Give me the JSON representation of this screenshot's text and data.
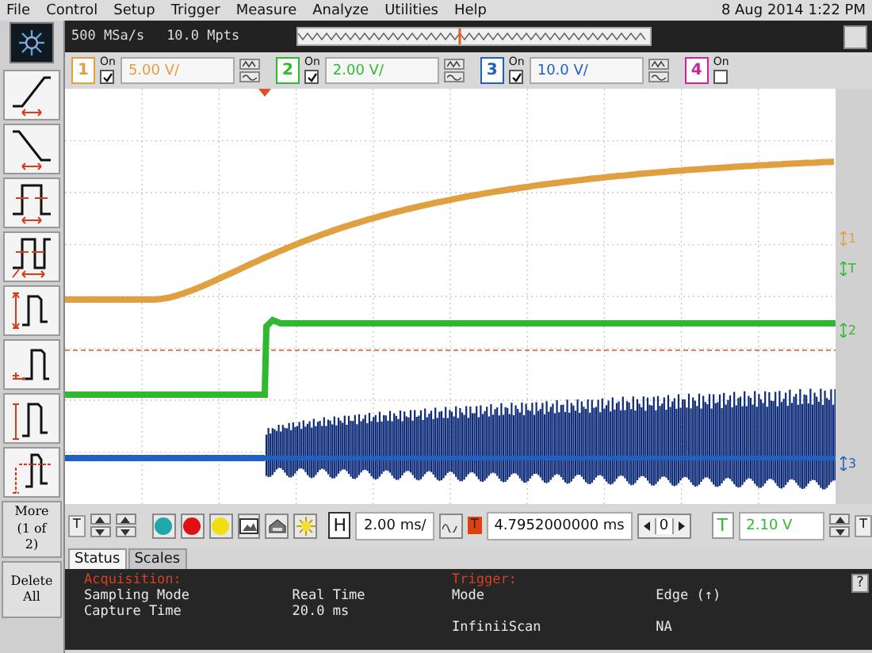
{
  "menu": [
    "File",
    "Control",
    "Setup",
    "Trigger",
    "Measure",
    "Analyze",
    "Utilities",
    "Help"
  ],
  "datetime": "8 Aug 2014  1:22 PM",
  "acquisition_bar": {
    "sample_rate": "500 MSa/s",
    "memory_depth": "10.0 Mpts"
  },
  "channels": [
    {
      "number": "1",
      "on_label": "On",
      "on": true,
      "scale": "5.00 V/",
      "color": "#e0a040"
    },
    {
      "number": "2",
      "on_label": "On",
      "on": true,
      "scale": "2.00 V/",
      "color": "#30b830"
    },
    {
      "number": "3",
      "on_label": "On",
      "on": true,
      "scale": "10.0 V/",
      "color": "#2060c0"
    },
    {
      "number": "4",
      "on_label": "On",
      "on": false,
      "color": "#d0209a"
    }
  ],
  "measurement_buttons": [
    {
      "kind": "rise"
    },
    {
      "kind": "fall"
    },
    {
      "kind": "width"
    },
    {
      "kind": "frequency"
    },
    {
      "kind": "peak"
    },
    {
      "kind": "average"
    },
    {
      "kind": "amplitude"
    },
    {
      "kind": "overshoot"
    }
  ],
  "more_button": "More (1 of 2)",
  "delete_button": "Delete All",
  "trace_markers": [
    {
      "label": "1",
      "color": "#e0a040"
    },
    {
      "label": "T",
      "color": "#30b830"
    },
    {
      "label": "2",
      "color": "#30b830"
    },
    {
      "label": "3",
      "color": "#2060c0"
    }
  ],
  "controls": {
    "left_marker": "T",
    "color_buttons": [
      {
        "color": "#20a8a8"
      },
      {
        "color": "#e01010"
      },
      {
        "color": "#f0e010"
      }
    ],
    "horizontal_label": "H",
    "time_scale": "2.00 ms/",
    "trigger_marker": "T",
    "delay": "4.7952000000 ms",
    "step": "0",
    "trigger_label": "T",
    "trigger_level": "2.10 V",
    "right_marker": "T"
  },
  "tabs": [
    {
      "label": "Status",
      "selected": true
    },
    {
      "label": "Scales",
      "selected": false
    }
  ],
  "status": [
    {
      "heading": "Acquisition:",
      "rows": [
        {
          "label": "Sampling Mode",
          "value": "Real Time"
        },
        {
          "label": "Capture Time",
          "value": "20.0 ms"
        }
      ]
    },
    {
      "heading": "Trigger:",
      "rows": [
        {
          "label": "Mode",
          "value": "Edge (↑)"
        },
        {
          "label": "InfiniiScan",
          "value": "NA"
        }
      ]
    }
  ],
  "help": "?"
}
